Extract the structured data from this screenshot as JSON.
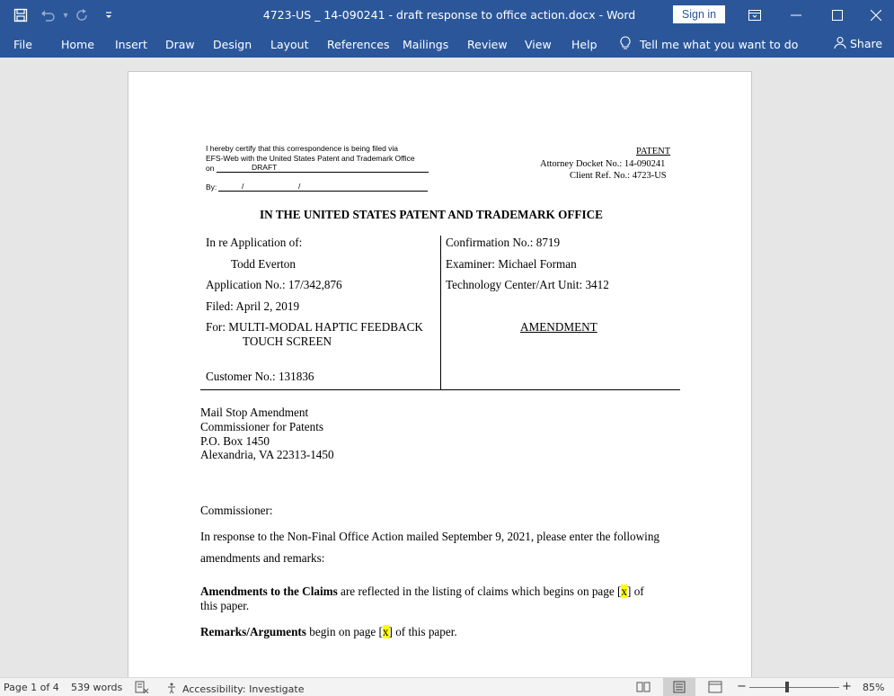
{
  "titlebar": {
    "title": "4723-US _ 14-090241 - draft response to office action.docx  -  Word",
    "signin": "Sign in"
  },
  "ribbon": {
    "tabs": [
      "File",
      "Home",
      "Insert",
      "Draw",
      "Design",
      "Layout",
      "References",
      "Mailings",
      "Review",
      "View",
      "Help"
    ],
    "tellme": "Tell me what you want to do",
    "share": "Share"
  },
  "doc": {
    "cert_line1": "I hereby certify that this correspondence is being filed via",
    "cert_line2": "EFS-Web with the United States Patent and Trademark Office",
    "cert_on": "on",
    "cert_draft": "DRAFT",
    "cert_by": "By:",
    "patent": "PATENT",
    "docket": "Attorney Docket No.: 14-090241",
    "client_ref": "Client Ref. No.: 4723-US",
    "heading": "IN THE UNITED STATES PATENT AND TRADEMARK OFFICE",
    "in_re": "In re Application of:",
    "inventor": "Todd Everton",
    "app_no": "Application No.:  17/342,876",
    "filed": "Filed: April 2, 2019",
    "for_line1": "For: MULTI-MODAL HAPTIC FEEDBACK",
    "for_line2": "TOUCH SCREEN",
    "customer_no": "Customer No.:  131836",
    "confirmation": "Confirmation No.:  8719",
    "examiner": "Examiner:  Michael Forman",
    "art_unit": "Technology Center/Art Unit: 3412",
    "amendment": "AMENDMENT",
    "addr1": "Mail Stop Amendment",
    "addr2": "Commissioner for Patents",
    "addr3": "P.O. Box 1450",
    "addr4": "Alexandria, VA 22313-1450",
    "salutation": "Commissioner:",
    "para1_line1": "In response to the Non-Final Office Action mailed September 9, 2021, please enter the following",
    "para1_line2": "amendments and remarks:",
    "claims_bold": "Amendments to the Claims",
    "claims_text": " are reflected in the listing of claims which begins on page [",
    "placeholder_x": "x",
    "claims_end": "] of",
    "claims_line2": "this paper.",
    "remarks_bold": "Remarks/Arguments",
    "remarks_text": " begin on page [",
    "remarks_end": "] of this paper."
  },
  "status": {
    "page": "Page 1 of 4",
    "words": "539 words",
    "accessibility": "Accessibility: Investigate",
    "zoom": "85%"
  },
  "colors": {
    "ribbon": "#2b579a",
    "highlight": "#ffff00"
  }
}
